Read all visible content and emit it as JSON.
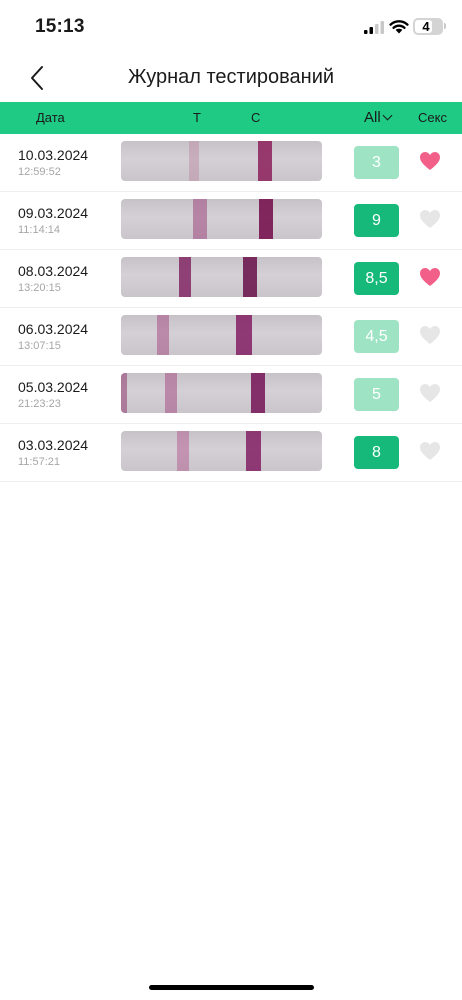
{
  "status_bar": {
    "time": "15:13",
    "battery": "4"
  },
  "nav": {
    "title": "Журнал тестирований"
  },
  "header": {
    "date": "Дата",
    "t": "T",
    "c": "C",
    "filter": "All",
    "sex": "Секс"
  },
  "colors": {
    "accent": "#1fcb84",
    "badge_dark": "#16b97a",
    "badge_light": "#9ee3c4",
    "heart_on": "#f26089",
    "heart_off": "#e6e6e6"
  },
  "entries": [
    {
      "date": "10.03.2024",
      "time": "12:59:52",
      "value": "3",
      "badge_tone": "light",
      "sex": true
    },
    {
      "date": "09.03.2024",
      "time": "11:14:14",
      "value": "9",
      "badge_tone": "dark",
      "sex": false
    },
    {
      "date": "08.03.2024",
      "time": "13:20:15",
      "value": "8,5",
      "badge_tone": "dark",
      "sex": true
    },
    {
      "date": "06.03.2024",
      "time": "13:07:15",
      "value": "4,5",
      "badge_tone": "light",
      "sex": false
    },
    {
      "date": "05.03.2024",
      "time": "21:23:23",
      "value": "5",
      "badge_tone": "light",
      "sex": false
    },
    {
      "date": "03.03.2024",
      "time": "11:57:21",
      "value": "8",
      "badge_tone": "dark",
      "sex": false
    }
  ]
}
